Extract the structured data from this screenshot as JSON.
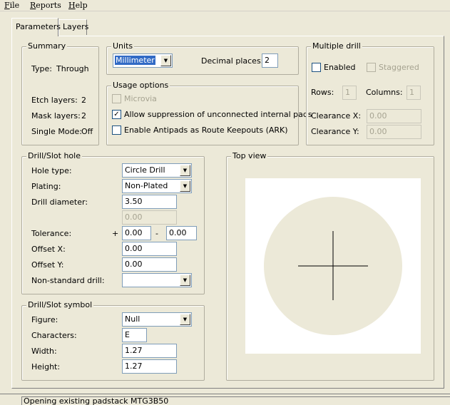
{
  "menu": {
    "file": {
      "accel": "F",
      "rest": "ile"
    },
    "reports": {
      "accel": "R",
      "rest": "eports"
    },
    "help": {
      "accel": "H",
      "rest": "elp"
    }
  },
  "tabs": [
    "Parameters",
    "Layers"
  ],
  "summary": {
    "title": "Summary",
    "type_label": "Type:",
    "type_value": "Through",
    "etch_label": "Etch layers:",
    "etch_value": "2",
    "mask_label": "Mask layers:",
    "mask_value": "2",
    "single_label": "Single Mode:",
    "single_value": "Off"
  },
  "units": {
    "title": "Units",
    "unit_value": "Millimeter",
    "decimal_label": "Decimal places:",
    "decimal_value": "2"
  },
  "usage": {
    "title": "Usage options",
    "microvia": {
      "label": "Microvia",
      "checked": false,
      "enabled": false
    },
    "allow_suppression": {
      "label": "Allow suppression of unconnected internal pads",
      "checked": true
    },
    "antipads": {
      "label": "Enable Antipads as Route Keepouts (ARK)",
      "checked": false
    }
  },
  "multi": {
    "title": "Multiple drill",
    "enabled_label": "Enabled",
    "staggered_label": "Staggered",
    "rows_label": "Rows:",
    "rows_value": "1",
    "columns_label": "Columns:",
    "columns_value": "1",
    "clearance_x_label": "Clearance X:",
    "clearance_x_value": "0.00",
    "clearance_y_label": "Clearance Y:",
    "clearance_y_value": "0.00"
  },
  "hole": {
    "title": "Drill/Slot hole",
    "hole_type_label": "Hole type:",
    "hole_type_value": "Circle Drill",
    "plating_label": "Plating:",
    "plating_value": "Non-Plated",
    "diameter_label": "Drill diameter:",
    "diameter_value": "3.50",
    "diameter2_value": "0.00",
    "tolerance_label": "Tolerance:",
    "tolerance_plus": "+",
    "tolerance_minus": "-",
    "tolerance_plus_value": "0.00",
    "tolerance_minus_value": "0.00",
    "offset_x_label": "Offset X:",
    "offset_x_value": "0.00",
    "offset_y_label": "Offset Y:",
    "offset_y_value": "0.00",
    "nonstd_label": "Non-standard drill:",
    "nonstd_value": ""
  },
  "symbol": {
    "title": "Drill/Slot symbol",
    "figure_label": "Figure:",
    "figure_value": "Null",
    "characters_label": "Characters:",
    "characters_value": "E",
    "width_label": "Width:",
    "width_value": "1.27",
    "height_label": "Height:",
    "height_value": "1.27"
  },
  "topview": {
    "title": "Top view",
    "bg_color": "#ffffff",
    "pad_color": "#ece9d8",
    "crosshair_color": "#000000"
  },
  "status": {
    "text": "Opening existing padstack MTG3B50"
  },
  "icons": {
    "dropdown": "chevron-down-icon",
    "check": "checkmark-icon"
  }
}
